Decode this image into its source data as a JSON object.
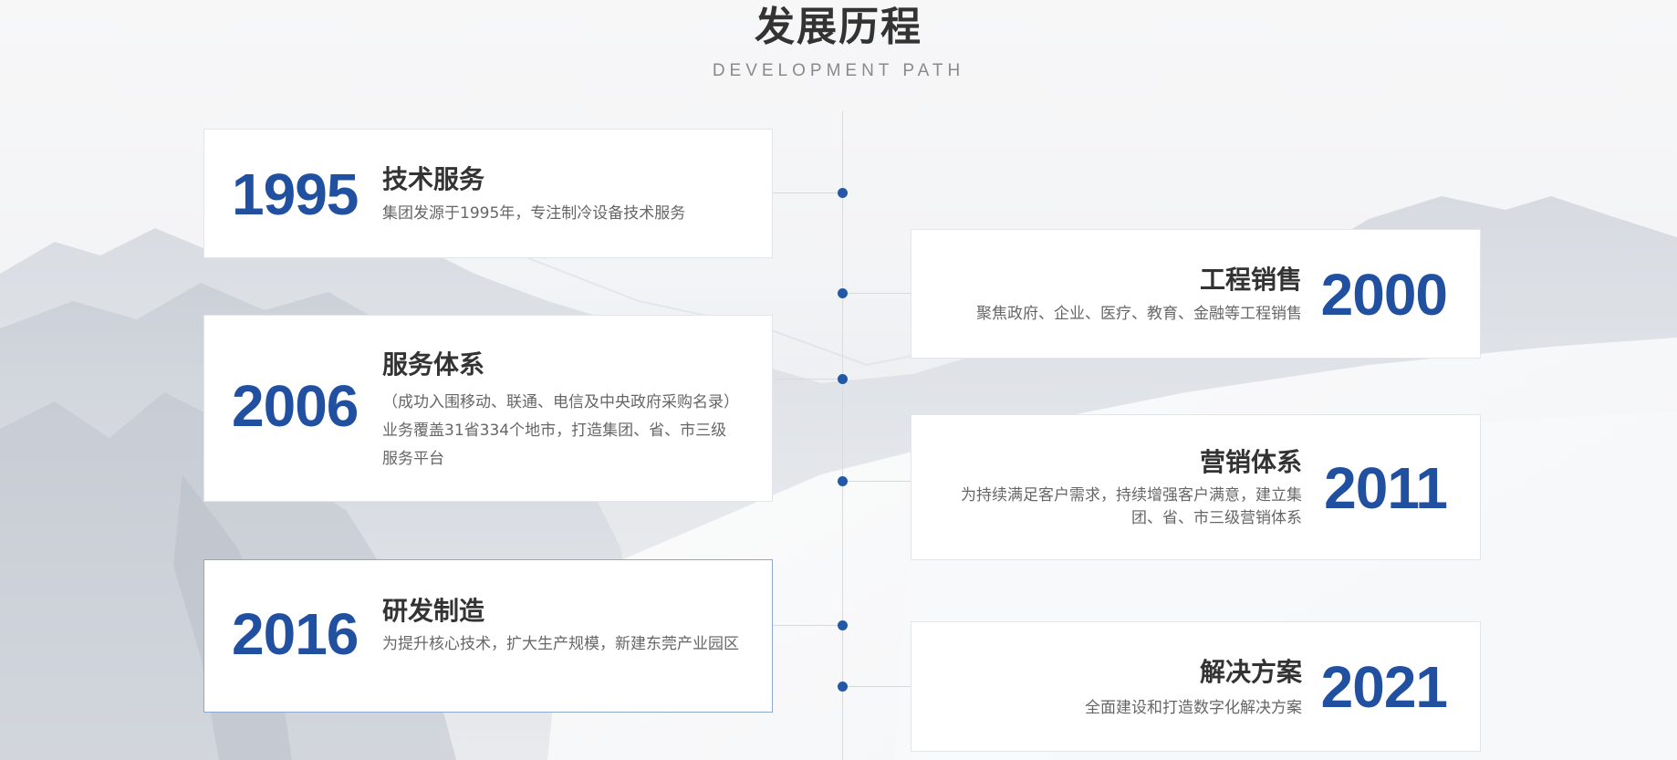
{
  "header": {
    "title": "发展历程",
    "subtitle": "DEVELOPMENT PATH"
  },
  "colors": {
    "accent": "#2150a0",
    "title": "#333333",
    "text": "#666666",
    "card_bg": "#ffffff",
    "line": "#d9dbe0"
  },
  "milestones": [
    {
      "year": "1995",
      "title": "技术服务",
      "desc": "集团发源于1995年，专注制冷设备技术服务",
      "side": "left"
    },
    {
      "year": "2000",
      "title": "工程销售",
      "desc": "聚焦政府、企业、医疗、教育、金融等工程销售",
      "side": "right"
    },
    {
      "year": "2006",
      "title": "服务体系",
      "desc": "（成功入围移动、联通、电信及中央政府采购名录）业务覆盖31省334个地市，打造集团、省、市三级服务平台",
      "side": "left"
    },
    {
      "year": "2011",
      "title": "营销体系",
      "desc": "为持续满足客户需求，持续增强客户满意，建立集团、省、市三级营销体系",
      "side": "right"
    },
    {
      "year": "2016",
      "title": "研发制造",
      "desc": "为提升核心技术，扩大生产规模，新建东莞产业园区",
      "side": "left"
    },
    {
      "year": "2021",
      "title": "解决方案",
      "desc": "全面建设和打造数字化解决方案",
      "side": "right"
    }
  ]
}
